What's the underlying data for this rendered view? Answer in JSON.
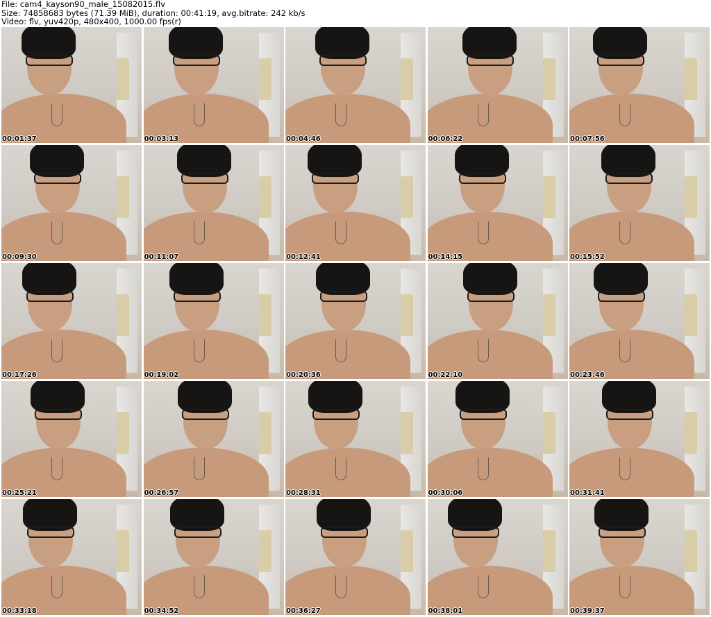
{
  "header": {
    "file_line": "File: cam4_kayson90_male_15082015.flv",
    "size_line": "Size: 74858683 bytes (71.39 MiB), duration: 00:41:19, avg.bitrate: 242 kb/s",
    "video_line": "Video: flv, yuv420p, 480x400, 1000.00 fps(r)"
  },
  "thumbnails": [
    {
      "time": "00:01:37"
    },
    {
      "time": "00:03:13"
    },
    {
      "time": "00:04:46"
    },
    {
      "time": "00:06:22"
    },
    {
      "time": "00:07:56"
    },
    {
      "time": "00:09:30"
    },
    {
      "time": "00:11:07"
    },
    {
      "time": "00:12:41"
    },
    {
      "time": "00:14:15"
    },
    {
      "time": "00:15:52"
    },
    {
      "time": "00:17:26"
    },
    {
      "time": "00:19:02"
    },
    {
      "time": "00:20:36"
    },
    {
      "time": "00:22:10"
    },
    {
      "time": "00:23:46"
    },
    {
      "time": "00:25:21"
    },
    {
      "time": "00:26:57"
    },
    {
      "time": "00:28:31"
    },
    {
      "time": "00:30:06"
    },
    {
      "time": "00:31:41"
    },
    {
      "time": "00:33:18"
    },
    {
      "time": "00:34:52"
    },
    {
      "time": "00:36:27"
    },
    {
      "time": "00:38:01"
    },
    {
      "time": "00:39:37"
    }
  ]
}
